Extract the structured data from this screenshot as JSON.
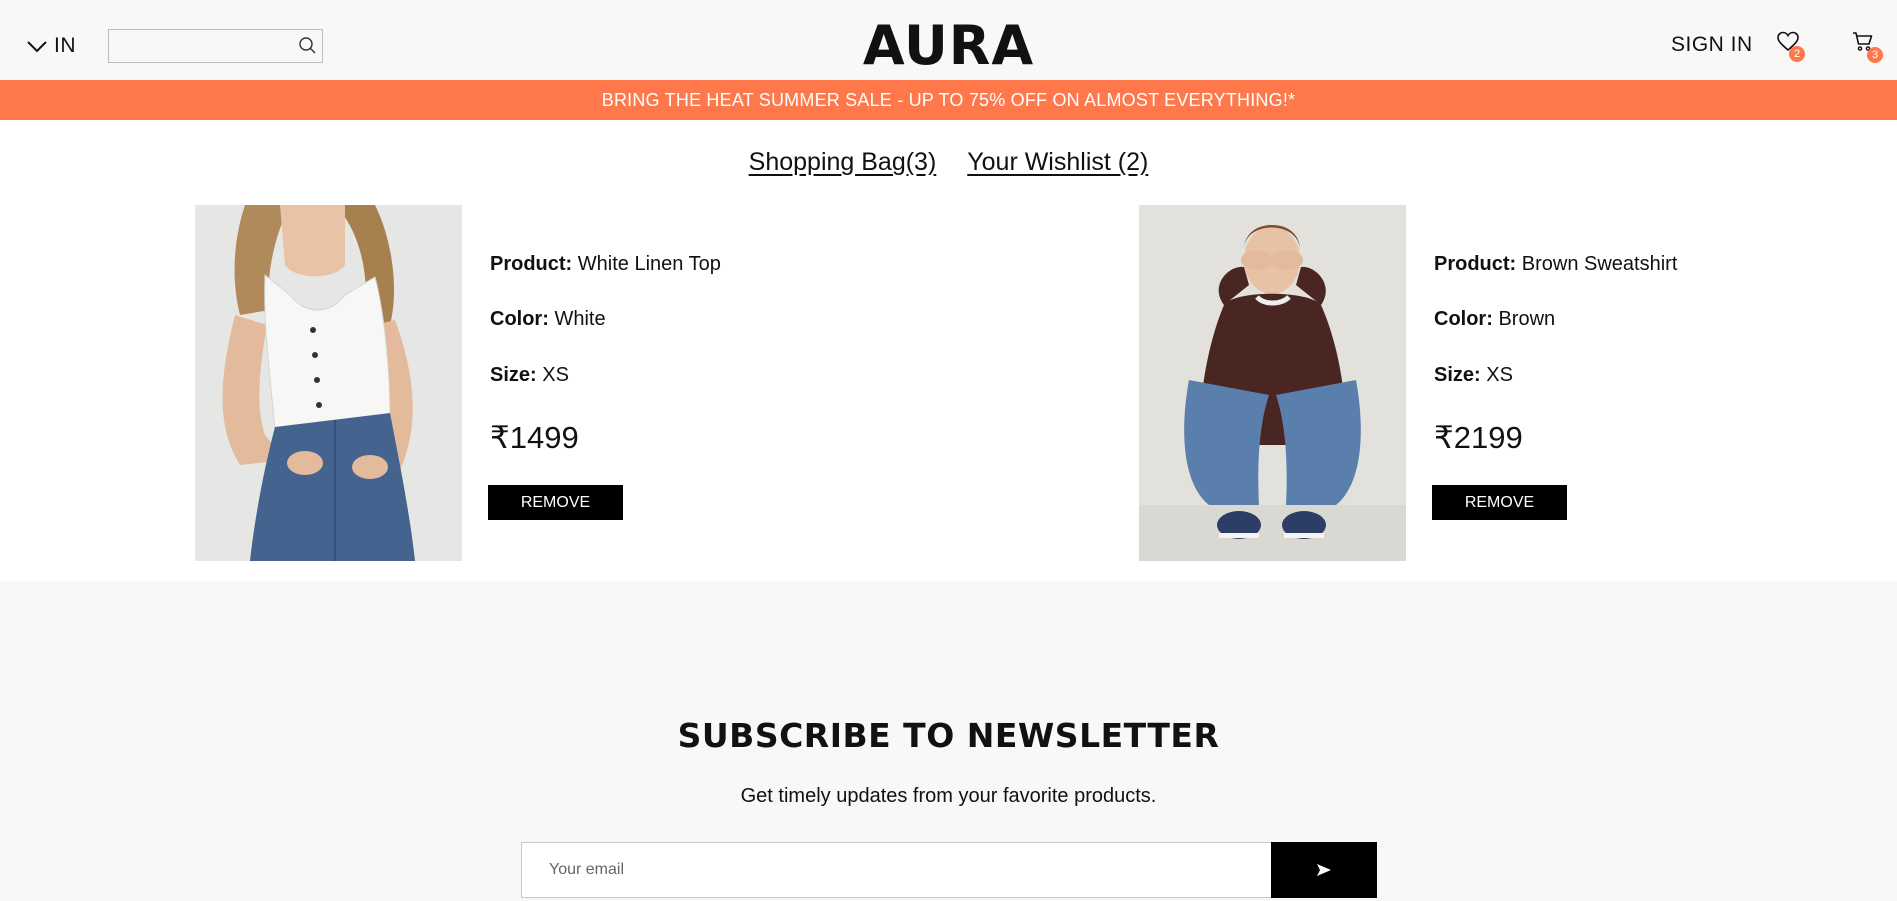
{
  "header": {
    "region_label": "IN",
    "search_placeholder": "",
    "logo": "AURA",
    "signin_label": "SIGN IN",
    "wishlist_count": "2",
    "cart_count": "3"
  },
  "banner": {
    "text": "BRING THE HEAT SUMMER SALE - UP TO 75% OFF ON ALMOST EVERYTHING!*"
  },
  "tabs": [
    {
      "label": "Shopping Bag(3)"
    },
    {
      "label": "Your Wishlist (2)"
    }
  ],
  "field_labels": {
    "product": "Product:",
    "color": "Color:",
    "size": "Size:"
  },
  "items": [
    {
      "product": "White Linen Top",
      "color": "White",
      "size": "XS",
      "price": "₹1499",
      "remove_label": "REMOVE"
    },
    {
      "product": "Brown Sweatshirt",
      "color": "Brown",
      "size": "XS",
      "price": "₹2199",
      "remove_label": "REMOVE"
    }
  ],
  "newsletter": {
    "title": "SUBSCRIBE TO NEWSLETTER",
    "subtitle": "Get timely updates from your favorite products.",
    "email_placeholder": "Your email"
  },
  "colors": {
    "accent": "#ff784b",
    "background": "#f9f8f6",
    "button": "#000000"
  },
  "icons": [
    "chevron-down-icon",
    "search-icon",
    "heart-icon",
    "cart-icon",
    "send-arrow-icon"
  ]
}
